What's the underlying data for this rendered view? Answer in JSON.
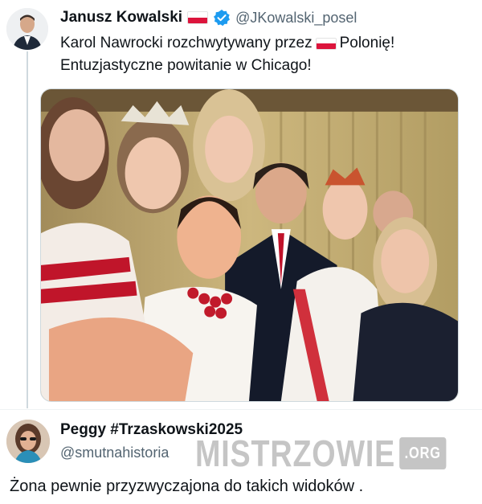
{
  "tweet": {
    "author_name": "Janusz Kowalski",
    "author_handle": "@JKowalski_posel",
    "avatar_icon": "user-avatar-icon",
    "flag_icon": "polish-flag-icon",
    "verified_icon": "verified-badge-icon",
    "text_line1_before": "Karol Nawrocki rozchwytywany przez",
    "text_line1_after": "Polonię!",
    "text_line2": "Entuzjastyczne powitanie w Chicago!",
    "photo_icon": "group-selfie-photo"
  },
  "reply": {
    "author_name": "Peggy #Trzaskowski2025",
    "author_handle": "@smutnahistoria",
    "avatar_icon": "user-avatar-icon",
    "text": "Żona pewnie przyzwyczajona do takich widoków ."
  },
  "watermark": {
    "main": "MISTRZOWIE",
    "suffix": ".ORG"
  },
  "colors": {
    "text": "#0f1419",
    "secondary": "#536471",
    "verified": "#1d9bf0",
    "flag_red": "#dc143c"
  }
}
